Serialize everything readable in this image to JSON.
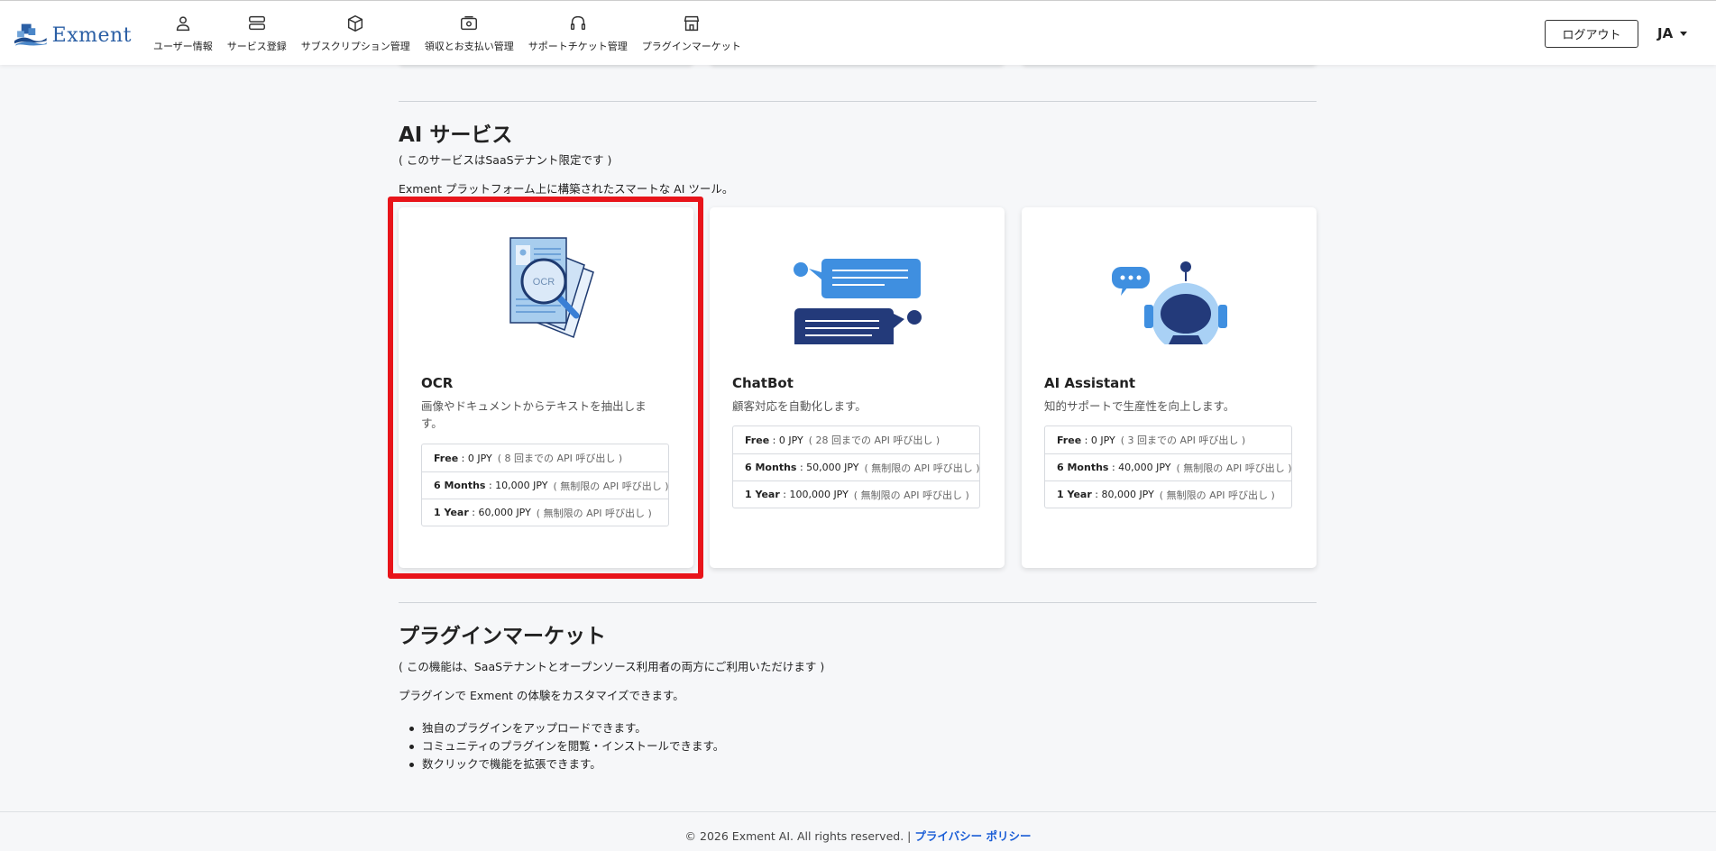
{
  "header": {
    "logo_text": "Exment",
    "nav": [
      {
        "label": "ユーザー情報",
        "icon": "user-icon"
      },
      {
        "label": "サービス登録",
        "icon": "server-icon"
      },
      {
        "label": "サブスクリプション管理",
        "icon": "box-icon"
      },
      {
        "label": "領収とお支払い管理",
        "icon": "money-icon"
      },
      {
        "label": "サポートチケット管理",
        "icon": "headset-icon"
      },
      {
        "label": "プラグインマーケット",
        "icon": "store-icon"
      }
    ],
    "logout_label": "ログアウト",
    "lang_label": "JA"
  },
  "ai_section": {
    "title": "AI サービス",
    "note": "( このサービスはSaaSテナント限定です )",
    "description": "Exment プラットフォーム上に構築されたスマートな AI ツール。",
    "cards": [
      {
        "title": "OCR",
        "description": "画像やドキュメントからテキストを抽出します。",
        "prices": [
          {
            "name": "Free",
            "amount": "0 JPY",
            "note": "( 8 回までの API 呼び出し )"
          },
          {
            "name": "6 Months",
            "amount": "10,000 JPY",
            "note": "( 無制限の API 呼び出し )"
          },
          {
            "name": "1 Year",
            "amount": "60,000 JPY",
            "note": "( 無制限の API 呼び出し )"
          }
        ]
      },
      {
        "title": "ChatBot",
        "description": "顧客対応を自動化します。",
        "prices": [
          {
            "name": "Free",
            "amount": "0 JPY",
            "note": "( 28 回までの API 呼び出し )"
          },
          {
            "name": "6 Months",
            "amount": "50,000 JPY",
            "note": "( 無制限の API 呼び出し )"
          },
          {
            "name": "1 Year",
            "amount": "100,000 JPY",
            "note": "( 無制限の API 呼び出し )"
          }
        ]
      },
      {
        "title": "AI Assistant",
        "description": "知的サポートで生産性を向上します。",
        "prices": [
          {
            "name": "Free",
            "amount": "0 JPY",
            "note": "( 3 回までの API 呼び出し )"
          },
          {
            "name": "6 Months",
            "amount": "40,000 JPY",
            "note": "( 無制限の API 呼び出し )"
          },
          {
            "name": "1 Year",
            "amount": "80,000 JPY",
            "note": "( 無制限の API 呼び出し )"
          }
        ]
      }
    ]
  },
  "plugin_section": {
    "title": "プラグインマーケット",
    "note": "( この機能は、SaaSテナントとオープンソース利用者の両方にご利用いただけます )",
    "description": "プラグインで Exment の体験をカスタマイズできます。",
    "bullets": [
      "独自のプラグインをアップロードできます。",
      "コミュニティのプラグインを閲覧・インストールできます。",
      "数クリックで機能を拡張できます。"
    ]
  },
  "footer": {
    "copyright": "© 2026 Exment AI. All rights reserved. |",
    "privacy_link": "プライバシー ポリシー"
  },
  "colors": {
    "highlight": "#e8141a",
    "link": "#1a5dd6",
    "logo": "#2b5fa5"
  }
}
